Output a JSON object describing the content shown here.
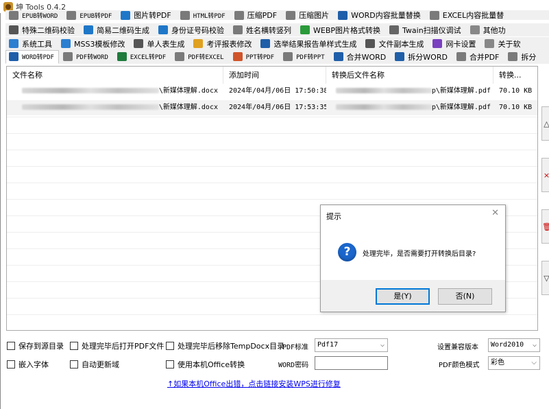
{
  "window": {
    "title": "坤 Tools 0.4.2"
  },
  "colors": {
    "accent": "#0078d7",
    "link": "#0000ee",
    "question_icon": "#1b66cc"
  },
  "tab_rows": [
    [
      {
        "label": "EPUB转WORD",
        "icon": "doc-icon",
        "small": true,
        "color": "#7a7a7a"
      },
      {
        "label": "EPUB转PDF",
        "icon": "doc-icon",
        "small": true,
        "color": "#7a7a7a"
      },
      {
        "label": "图片转PDF",
        "icon": "image-icon",
        "small": false,
        "color": "#1f77c8"
      },
      {
        "label": "HTML转PDF",
        "icon": "doc-icon",
        "small": true,
        "color": "#7a7a7a"
      },
      {
        "label": "压缩PDF",
        "icon": "compress-icon",
        "small": false,
        "color": "#7a7a7a"
      },
      {
        "label": "压缩图片",
        "icon": "compress-icon",
        "small": false,
        "color": "#7a7a7a"
      },
      {
        "label": "WORD内容批量替换",
        "icon": "word-icon",
        "small": false,
        "color": "#1f5ea8"
      },
      {
        "label": "EXCEL内容批量替",
        "icon": "doc-icon",
        "small": false,
        "color": "#7a7a7a"
      }
    ],
    [
      {
        "label": "特殊二维码校验",
        "icon": "qrcode-icon",
        "small": false,
        "color": "#555555"
      },
      {
        "label": "简易二维码生成",
        "icon": "qrcode-icon",
        "small": false,
        "color": "#1f77c8"
      },
      {
        "label": "身份证号码校验",
        "icon": "id-card-icon",
        "small": false,
        "color": "#1f77c8"
      },
      {
        "label": "姓名横转竖列",
        "icon": "text-icon",
        "small": false,
        "color": "#7a7a7a"
      },
      {
        "label": "WEBP图片格式转换",
        "icon": "image-icon",
        "small": false,
        "color": "#2a9a3a"
      },
      {
        "label": "Twain扫描仪调试",
        "icon": "scanner-icon",
        "small": false,
        "color": "#666666"
      },
      {
        "label": "其他功",
        "icon": "more-icon",
        "small": false,
        "color": "#888888"
      }
    ],
    [
      {
        "label": "系统工具",
        "icon": "gear-icon",
        "small": false,
        "color": "#2a7fd0"
      },
      {
        "label": "MSS3模板修改",
        "icon": "gear-icon",
        "small": false,
        "color": "#2a7fd0"
      },
      {
        "label": "单人表生成",
        "icon": "doc-icon",
        "small": false,
        "color": "#555555"
      },
      {
        "label": "考评报表修改",
        "icon": "edit-icon",
        "small": false,
        "color": "#e0a020"
      },
      {
        "label": "选举结果报告单样式生成",
        "icon": "list-icon",
        "small": false,
        "color": "#1f5ea8"
      },
      {
        "label": "文件副本生成",
        "icon": "copy-icon",
        "small": false,
        "color": "#555555"
      },
      {
        "label": "网卡设置",
        "icon": "network-icon",
        "small": false,
        "color": "#7a3fc0"
      },
      {
        "label": "关于软",
        "icon": "info-icon",
        "small": false,
        "color": "#888888"
      }
    ],
    [
      {
        "label": "WORD转PDF",
        "icon": "word-icon",
        "small": true,
        "color": "#1f5ea8",
        "active": true
      },
      {
        "label": "PDF转WORD",
        "icon": "pdf-icon",
        "small": true,
        "color": "#7a7a7a"
      },
      {
        "label": "EXCEL转PDF",
        "icon": "excel-icon",
        "small": true,
        "color": "#1e7b3c"
      },
      {
        "label": "PDF转EXCEL",
        "icon": "pdf-icon",
        "small": true,
        "color": "#7a7a7a"
      },
      {
        "label": "PPT转PDF",
        "icon": "ppt-icon",
        "small": true,
        "color": "#d0542a"
      },
      {
        "label": "PDF转PPT",
        "icon": "pdf-icon",
        "small": true,
        "color": "#7a7a7a"
      },
      {
        "label": "合并WORD",
        "icon": "merge-icon",
        "small": false,
        "color": "#1f5ea8"
      },
      {
        "label": "拆分WORD",
        "icon": "split-icon",
        "small": false,
        "color": "#1f5ea8"
      },
      {
        "label": "合并PDF",
        "icon": "pdf-icon",
        "small": false,
        "color": "#7a7a7a"
      },
      {
        "label": "拆分",
        "icon": "pdf-icon",
        "small": false,
        "color": "#7a7a7a"
      }
    ]
  ],
  "file_list": {
    "columns": [
      "文件名称",
      "添加时间",
      "转换后文件名称",
      "转换..."
    ],
    "rows": [
      {
        "source_name": "\\新媒体理解.docx",
        "added_time": "2024年/04月/06日 17:50:38",
        "output_name": "p\\新媒体理解.pdf",
        "size": "70.10 KB"
      },
      {
        "source_name": "\\新媒体理解.docx",
        "added_time": "2024年/04月/06日 17:53:35",
        "output_name": "p\\新媒体理解.pdf",
        "size": "70.10 KB"
      }
    ]
  },
  "side_buttons": [
    {
      "name": "scroll-up-button",
      "glyph": "△"
    },
    {
      "name": "remove-button",
      "glyph": "×"
    },
    {
      "name": "delete-button",
      "glyph": "🗑"
    },
    {
      "name": "scroll-down-button",
      "glyph": "▽"
    }
  ],
  "dialog": {
    "title": "提示",
    "message": "处理完毕，是否需要打开转换后目录?",
    "icon": "question-icon",
    "yes_label": "是(Y)",
    "no_label": "否(N)"
  },
  "options": {
    "save_to_source": "保存到源目录",
    "open_pdf_after": "处理完毕后打开PDF文件",
    "remove_temp_after": "处理完毕后移除TempDocx目录",
    "embed_fonts": "嵌入字体",
    "auto_update_fields": "自动更新域",
    "use_local_office": "使用本机Office转换",
    "pdf_standard_label": "PDF标准",
    "pdf_standard_value": "Pdf17",
    "compat_version_label": "设置兼容版本",
    "compat_version_value": "Word2010",
    "word_password_label": "WORD密码",
    "word_password_value": "",
    "pdf_color_label": "PDF颜色模式",
    "pdf_color_value": "彩色"
  },
  "repair_link": "↑如果本机Office出错，点击链接安装WPS进行修复"
}
